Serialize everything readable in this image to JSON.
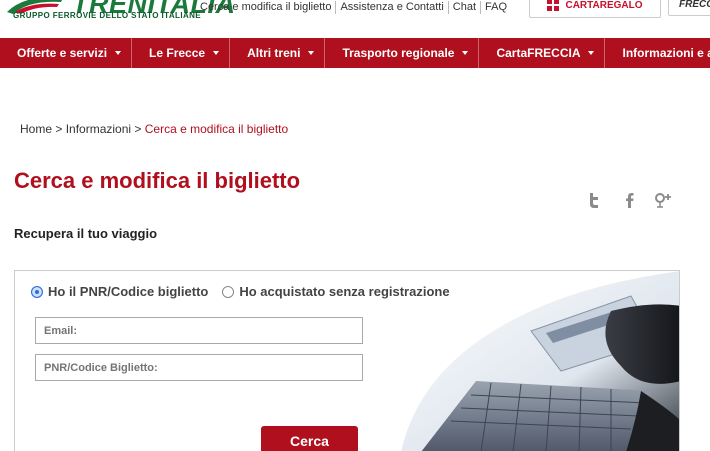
{
  "brand": {
    "name": "TRENITALIA",
    "tagline": "GRUPPO FERROVIE DELLO STATO ITALIANE",
    "color_green": "#1a7a3c",
    "color_red": "#b0101e"
  },
  "top_links": [
    "Cerca e modifica il biglietto",
    "Assistenza e Contatti",
    "Chat",
    "FAQ"
  ],
  "top_buttons": {
    "cartaregalo": "CARTAREGALO",
    "frecce": "FRECCE"
  },
  "nav": {
    "items": [
      {
        "label": "Offerte e servizi"
      },
      {
        "label": "Le Frecce"
      },
      {
        "label": "Altri treni"
      },
      {
        "label": "Trasporto regionale"
      },
      {
        "label": "CartaFRECCIA"
      },
      {
        "label": "Informazioni e assistenza"
      }
    ]
  },
  "breadcrumb": {
    "home": "Home",
    "sep": " > ",
    "section": "Informazioni",
    "current": "Cerca e modifica il biglietto"
  },
  "page_title": "Cerca e modifica il biglietto",
  "social_icons": [
    "twitter-icon",
    "facebook-icon",
    "google-plus-icon"
  ],
  "subtitle": "Recupera il tuo viaggio",
  "form": {
    "options": [
      {
        "label": "Ho il PNR/Codice biglietto",
        "selected": true
      },
      {
        "label": "Ho acquistato senza registrazione",
        "selected": false
      }
    ],
    "email_placeholder": "Email:",
    "pnr_placeholder": "PNR/Codice Biglietto:",
    "submit_label": "Cerca"
  }
}
